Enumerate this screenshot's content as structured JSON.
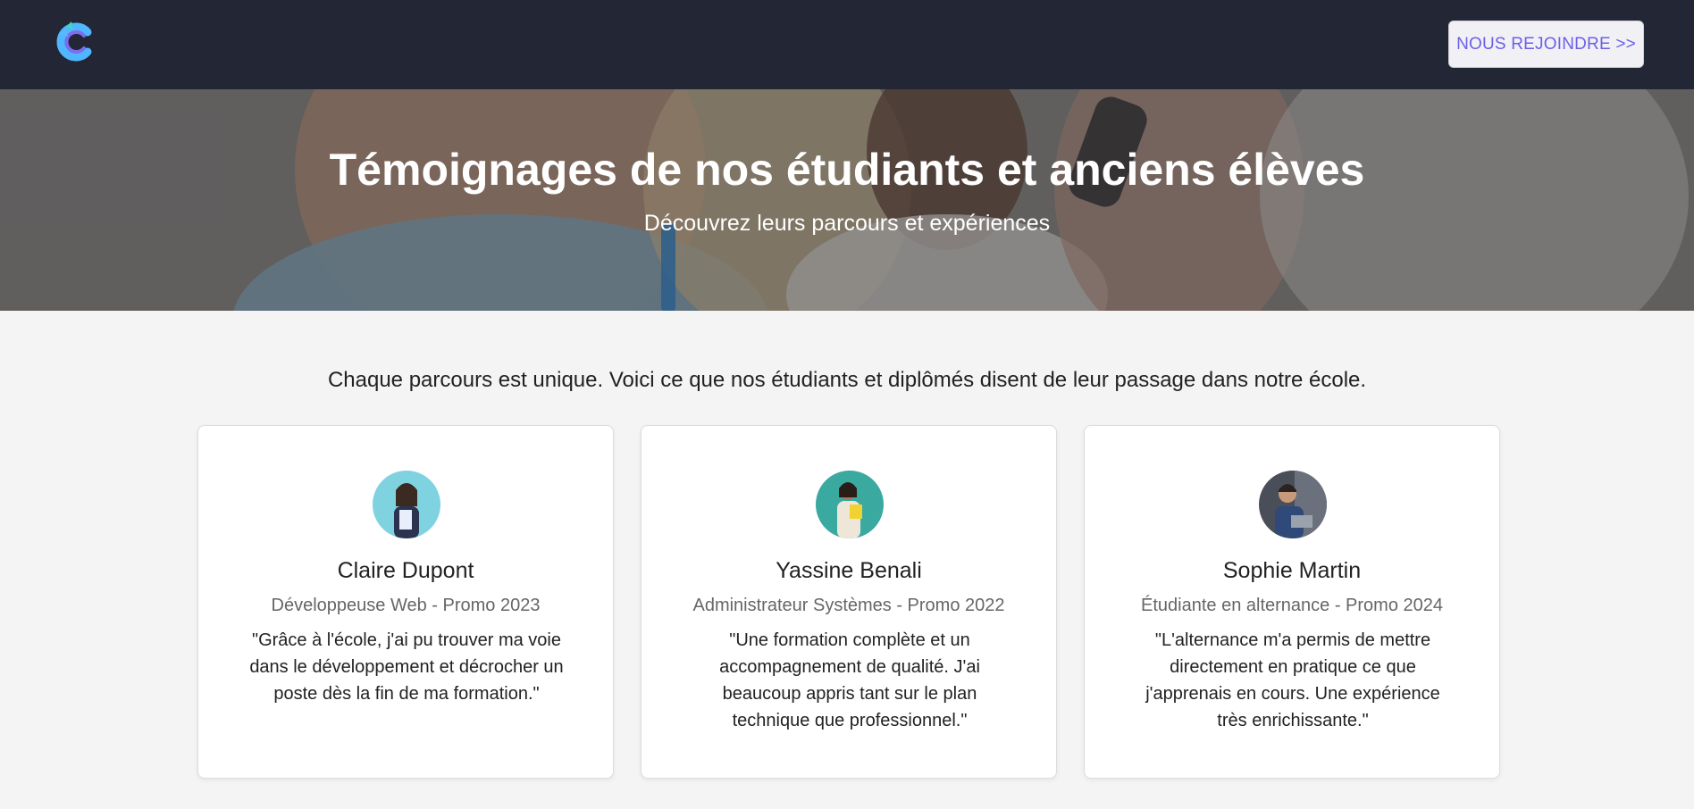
{
  "header": {
    "logo_icon": "c-logo-icon",
    "join_button_label": "NOUS REJOINDRE >>"
  },
  "hero": {
    "title": "Témoignages de nos étudiants et anciens élèves",
    "subtitle": "Découvrez leurs parcours et expériences"
  },
  "intro": {
    "text": "Chaque parcours est unique. Voici ce que nos étudiants et diplômés disent de leur passage dans notre école."
  },
  "testimonials": [
    {
      "name": "Claire Dupont",
      "role": "Développeuse Web - Promo 2023",
      "quote": "\"Grâce à l'école, j'ai pu trouver ma voie dans le développement et décrocher un poste dès la fin de ma formation.\""
    },
    {
      "name": "Yassine Benali",
      "role": "Administrateur Systèmes - Promo 2022",
      "quote": "\"Une formation complète et un accompagnement de qualité. J'ai beaucoup appris tant sur le plan technique que professionnel.\""
    },
    {
      "name": "Sophie Martin",
      "role": "Étudiante en alternance - Promo 2024",
      "quote": "\"L'alternance m'a permis de mettre directement en pratique ce que j'apprenais en cours. Une expérience très enrichissante.\""
    }
  ],
  "colors": {
    "navbar": "#232634",
    "accent": "#6b5fe8",
    "page_background": "#f4f4f4"
  }
}
